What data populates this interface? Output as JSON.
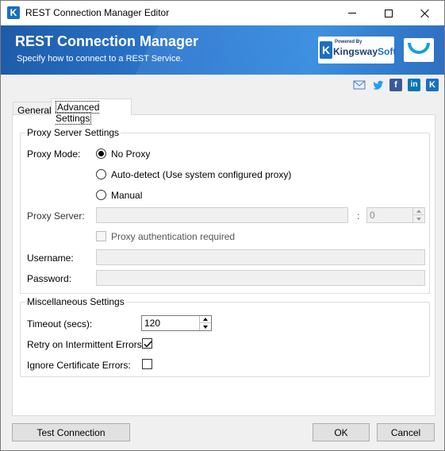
{
  "window": {
    "title": "REST Connection Manager Editor"
  },
  "banner": {
    "title": "REST Connection Manager",
    "subtitle": "Specify how to connect to a REST Service.",
    "logo_powered": "Powered By",
    "logo_name_1": "Kingsway",
    "logo_name_2": "Soft"
  },
  "social": {
    "icons": [
      "mail-icon",
      "twitter-icon",
      "facebook-icon",
      "linkedin-icon",
      "kingswaysoft-icon"
    ]
  },
  "tabs": [
    {
      "label": "General",
      "active": false
    },
    {
      "label": "Advanced Settings",
      "active": true
    }
  ],
  "proxy": {
    "legend": "Proxy Server Settings",
    "mode_label": "Proxy Mode:",
    "options": [
      {
        "label": "No Proxy",
        "checked": true
      },
      {
        "label": "Auto-detect (Use system configured proxy)",
        "checked": false
      },
      {
        "label": "Manual",
        "checked": false
      }
    ],
    "server_label": "Proxy Server:",
    "server_value": "",
    "port_separator": ":",
    "port_value": "0",
    "auth_label": "Proxy authentication required",
    "username_label": "Username:",
    "username_value": "",
    "password_label": "Password:",
    "password_value": ""
  },
  "misc": {
    "legend": "Miscellaneous Settings",
    "timeout_label": "Timeout (secs):",
    "timeout_value": "120",
    "retry_label": "Retry on Intermittent Errors:",
    "retry_checked": true,
    "ignore_cert_label": "Ignore Certificate Errors:",
    "ignore_cert_checked": false
  },
  "buttons": {
    "test": "Test Connection",
    "ok": "OK",
    "cancel": "Cancel"
  },
  "colors": {
    "banner": "#2d7bd4",
    "brand": "#1a6fc2"
  }
}
